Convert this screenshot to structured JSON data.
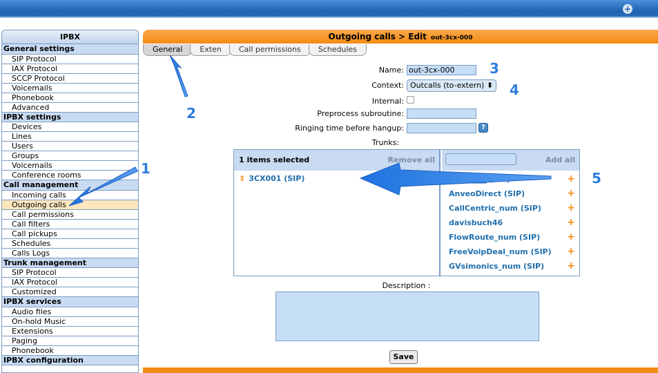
{
  "sidebar": {
    "title": "IPBX",
    "sections": [
      {
        "label": "General settings",
        "items": [
          "SIP Protocol",
          "IAX Protocol",
          "SCCP Protocol",
          "Voicemails",
          "Phonebook",
          "Advanced"
        ]
      },
      {
        "label": "IPBX settings",
        "items": [
          "Devices",
          "Lines",
          "Users",
          "Groups",
          "Voicemails",
          "Conference rooms"
        ]
      },
      {
        "label": "Call management",
        "items": [
          "Incoming calls",
          "Outgoing calls",
          "Call permissions",
          "Call filters",
          "Call pickups",
          "Schedules",
          "Calls Logs"
        ]
      },
      {
        "label": "Trunk management",
        "items": [
          "SIP Protocol",
          "IAX Protocol",
          "Customized"
        ]
      },
      {
        "label": "IPBX services",
        "items": [
          "Audio files",
          "On-hold Music",
          "Extensions",
          "Paging",
          "Phonebook"
        ]
      },
      {
        "label": "IPBX configuration",
        "items": []
      }
    ]
  },
  "main": {
    "header_title": "Outgoing calls > Edit",
    "header_sub": "out-3cx-000",
    "tabs": [
      {
        "label": "General",
        "active": true
      },
      {
        "label": "Exten",
        "active": false
      },
      {
        "label": "Call permissions",
        "active": false
      },
      {
        "label": "Schedules",
        "active": false
      }
    ],
    "form": {
      "name_label": "Name:",
      "name_value": "out-3cx-000",
      "context_label": "Context:",
      "context_value": "Outcalls (to-extern) ⬍",
      "internal_label": "Internal:",
      "preprocess_label": "Preprocess subroutine:",
      "ringing_label": "Ringing time before hangup:",
      "trunks_label": "Trunks:",
      "description_label": "Description :",
      "save_label": "Save"
    },
    "trunks": {
      "selected_header": "1 items selected",
      "remove_all": "Remove all",
      "add_all": "Add all",
      "selected": [
        "3CX001 (SIP)"
      ],
      "available": [
        "__________ (SIP)",
        "AnveoDirect (SIP)",
        "CallCentric_num (SIP)",
        "davisbuch46",
        "FlowRoute_num (SIP)",
        "FreeVoipDeal_num (SIP)",
        "GVsimonics_num (SIP)"
      ]
    }
  },
  "annotations": [
    "1",
    "2",
    "3",
    "4",
    "5"
  ],
  "colors": {
    "accent_blue": "#2f7de0",
    "orange": "#f38b12",
    "panel_blue": "#c9dbf2"
  }
}
